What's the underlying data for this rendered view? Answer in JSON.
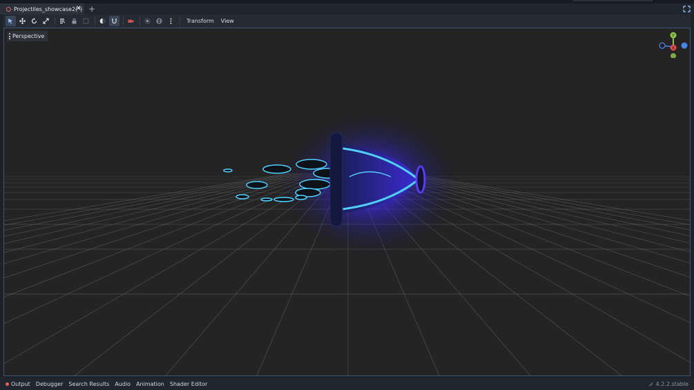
{
  "scene_tab": {
    "title": "Projectiles_showcase2(*)",
    "close_glyph": "✕",
    "add_glyph": "+",
    "icon": "scene-node-icon"
  },
  "toolbar": {
    "menus": [
      "Transform",
      "View"
    ],
    "tools": [
      "select-icon",
      "move-icon",
      "rotate-icon",
      "scale-icon",
      "list-select-icon",
      "lock-icon",
      "group-icon",
      "local-space-icon",
      "snap-icon",
      "camera-override-icon",
      "sun-preview-icon",
      "environment-preview-icon",
      "more-options-icon"
    ]
  },
  "viewport": {
    "perspective_label": "Perspective",
    "gizmo_axes": [
      "Y",
      "X",
      "Z"
    ],
    "colors": {
      "grid": "#8f9399",
      "glow": "#3b28ff",
      "energy": "#4fd2ff",
      "gizmo_x": "#e64a4a",
      "gizmo_y": "#8ec44a",
      "gizmo_z": "#4a86e6"
    }
  },
  "bottom_panel": {
    "tabs": [
      "Output",
      "Debugger",
      "Search Results",
      "Audio",
      "Animation",
      "Shader Editor"
    ],
    "version": "4.2.2.stable"
  }
}
